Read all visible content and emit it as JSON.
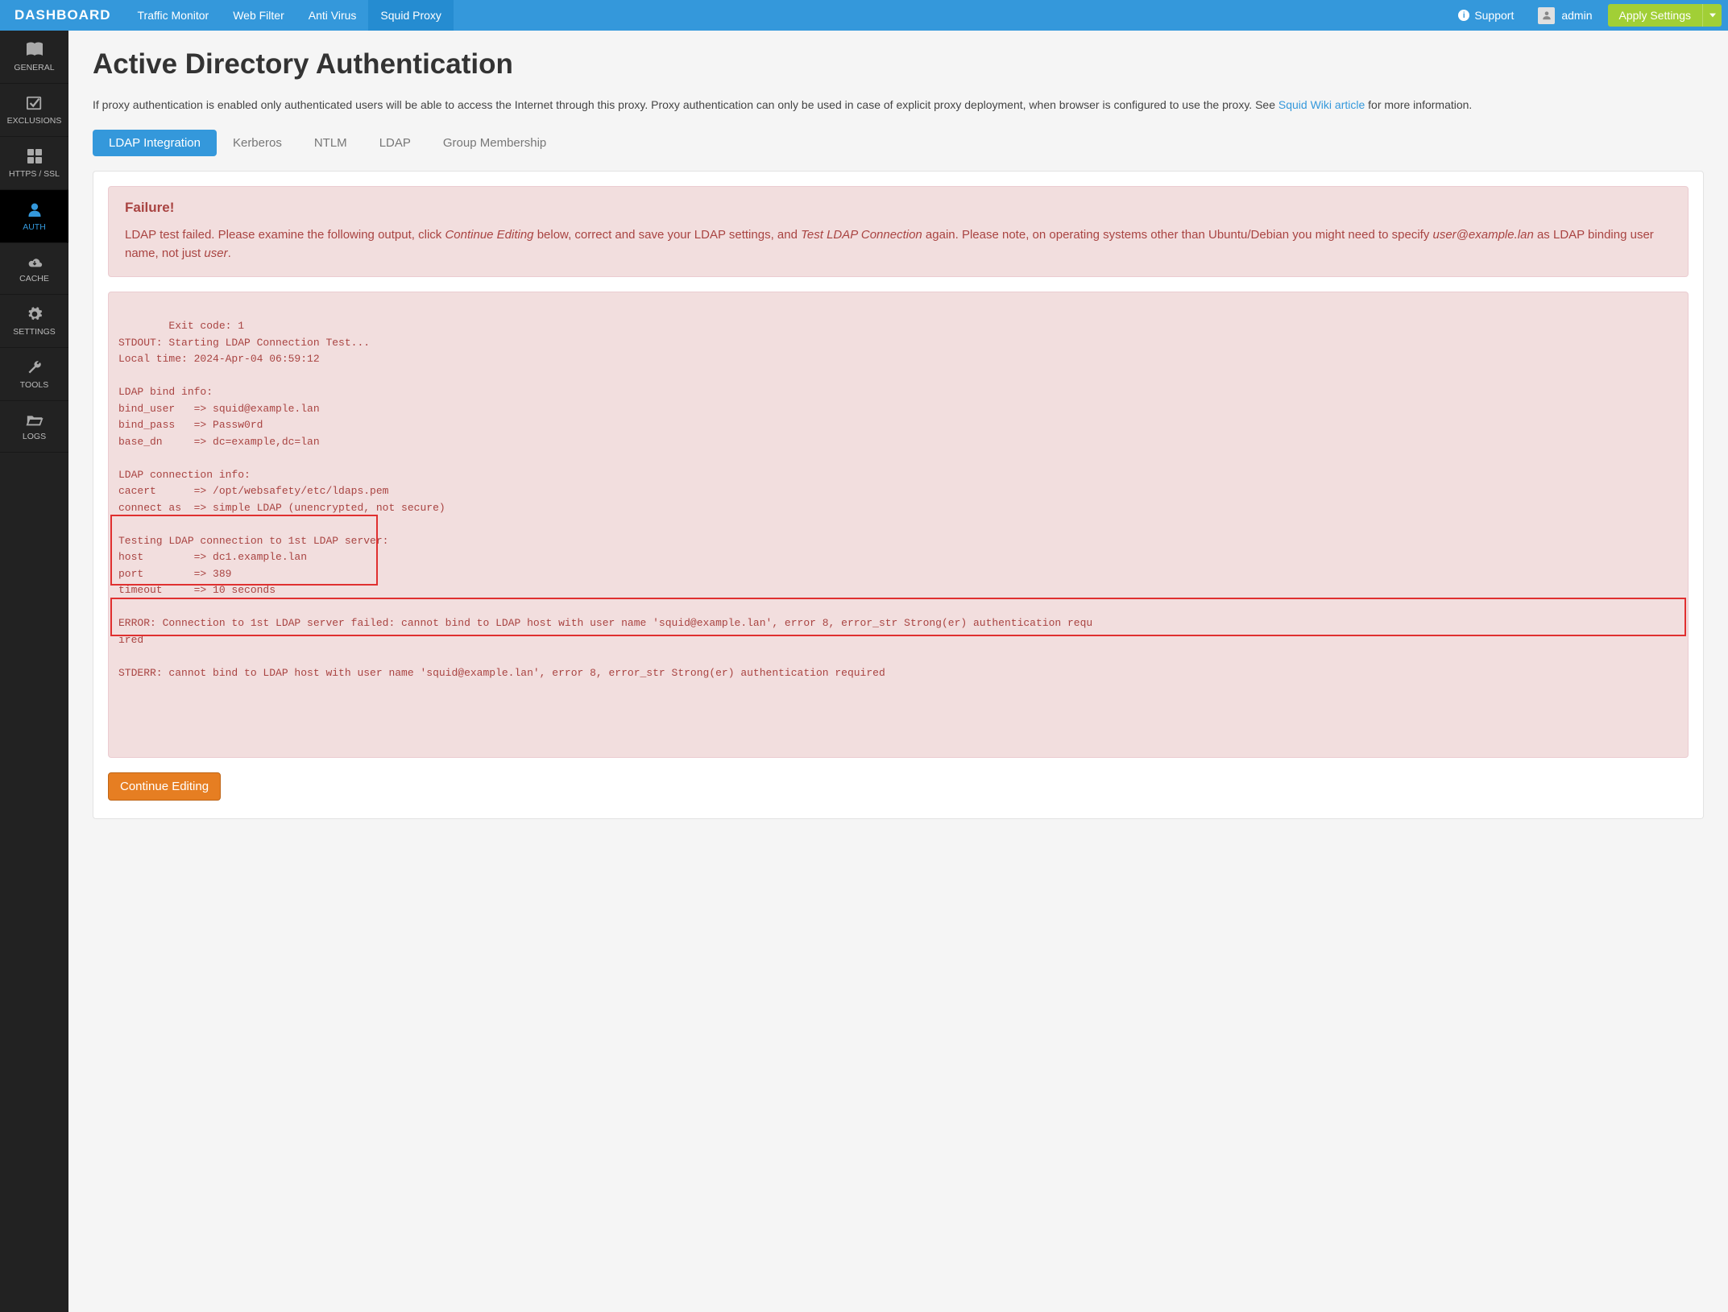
{
  "topnav": {
    "brand": "DASHBOARD",
    "items": [
      "Traffic Monitor",
      "Web Filter",
      "Anti Virus",
      "Squid Proxy"
    ],
    "activeIndex": 3,
    "support": "Support",
    "user": "admin",
    "apply": "Apply Settings"
  },
  "sidebar": {
    "items": [
      {
        "label": "GENERAL",
        "icon": "book"
      },
      {
        "label": "EXCLUSIONS",
        "icon": "check-square"
      },
      {
        "label": "HTTPS / SSL",
        "icon": "grid"
      },
      {
        "label": "AUTH",
        "icon": "user"
      },
      {
        "label": "CACHE",
        "icon": "cloud-down"
      },
      {
        "label": "SETTINGS",
        "icon": "gear"
      },
      {
        "label": "TOOLS",
        "icon": "wrench"
      },
      {
        "label": "LOGS",
        "icon": "folder-open"
      }
    ],
    "activeIndex": 3
  },
  "page": {
    "title": "Active Directory Authentication",
    "desc_pre": "If proxy authentication is enabled only authenticated users will be able to access the Internet through this proxy. Proxy authentication can only be used in case of explicit proxy deployment, when browser is configured to use the proxy. See ",
    "desc_link": "Squid Wiki article",
    "desc_post": " for more information."
  },
  "tabs": {
    "items": [
      "LDAP Integration",
      "Kerberos",
      "NTLM",
      "LDAP",
      "Group Membership"
    ],
    "activeIndex": 0
  },
  "alert": {
    "title": "Failure!",
    "l1a": "LDAP test failed. Please examine the following output, click ",
    "l1b": "Continue Editing",
    "l1c": " below, correct and save your LDAP settings, and ",
    "l1d": "Test LDAP Connection",
    "l1e": " again. Please note, on operating systems other than Ubuntu/Debian you might need to specify ",
    "l1f": "user@example.lan",
    "l1g": " as LDAP binding user name, not just ",
    "l1h": "user",
    "l1i": "."
  },
  "pre": "Exit code: 1\nSTDOUT: Starting LDAP Connection Test...\nLocal time: 2024-Apr-04 06:59:12\n\nLDAP bind info:\nbind_user   => squid@example.lan\nbind_pass   => Passw0rd\nbase_dn     => dc=example,dc=lan\n\nLDAP connection info:\ncacert      => /opt/websafety/etc/ldaps.pem\nconnect as  => simple LDAP (unencrypted, not secure)\n\nTesting LDAP connection to 1st LDAP server:\nhost        => dc1.example.lan\nport        => 389\ntimeout     => 10 seconds\n\nERROR: Connection to 1st LDAP server failed: cannot bind to LDAP host with user name 'squid@example.lan', error 8, error_str Strong(er) authentication requ\nired\n\nSTDERR: cannot bind to LDAP host with user name 'squid@example.lan', error 8, error_str Strong(er) authentication required\n",
  "continue_btn": "Continue Editing"
}
